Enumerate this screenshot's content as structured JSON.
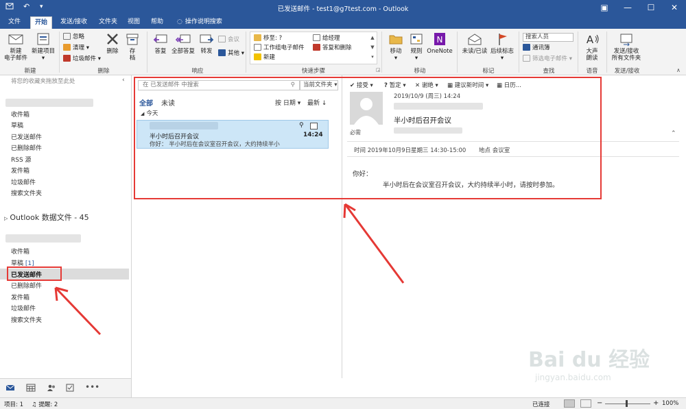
{
  "window": {
    "title": "已发送邮件 - test1@g7test.com - Outlook",
    "restore_icon": "▣",
    "minimize_icon": "—",
    "maximize_icon": "☐",
    "close_icon": "✕"
  },
  "tabs": [
    {
      "label": "文件"
    },
    {
      "label": "开始"
    },
    {
      "label": "发送/接收"
    },
    {
      "label": "文件夹"
    },
    {
      "label": "视图"
    },
    {
      "label": "帮助"
    },
    {
      "label": "操作说明搜索"
    }
  ],
  "ribbon": {
    "new_email": "新建\n电子邮件",
    "new_item": "新建项目",
    "group_new": "新建",
    "ignore": "忽略",
    "cleanup": "清理",
    "junk": "垃圾邮件",
    "delete": "删除",
    "archive": "存\n档",
    "group_delete": "删除",
    "reply": "答复",
    "reply_all": "全部答复",
    "forward": "转发",
    "meeting": "会议",
    "more": "其他",
    "group_respond": "响应",
    "qs_move": "移至: ?",
    "qs_team": "工作组电子邮件",
    "qs_new": "新建",
    "qs_manager": "给经理",
    "qs_reply_delete": "答复和删除",
    "group_quicksteps": "快速步骤",
    "move": "移动",
    "rules": "规则",
    "onenote": "OneNote",
    "group_move": "移动",
    "unread_read": "未读/已读",
    "followup": "后续标志",
    "group_tags": "标记",
    "search_people": "搜索人员",
    "address_book": "通讯簿",
    "filter_email": "筛选电子邮件",
    "group_find": "查找",
    "read_aloud": "大声\n朗读",
    "group_speech": "语音",
    "send_receive_all": "发送/接收\n所有文件夹",
    "group_sendreceive": "发送/接收"
  },
  "nav": {
    "favorites_hint": "将您的收藏夹拖放至此处",
    "account1_folders": [
      "收件箱",
      "草稿",
      "已发送邮件",
      "已删除邮件",
      "RSS 源",
      "发件箱",
      "垃圾邮件",
      "搜索文件夹"
    ],
    "datafile": "Outlook 数据文件 - 45",
    "account2_folders": [
      "收件箱",
      "草稿",
      "已发送邮件",
      "已删除邮件",
      "发件箱",
      "垃圾邮件",
      "搜索文件夹"
    ],
    "drafts_count": "[1]"
  },
  "list": {
    "search_placeholder": "在 已发送邮件 中搜索",
    "scope": "当前文件夹",
    "filter_all": "全部",
    "filter_unread": "未读",
    "sort_by": "按 日期",
    "sort_order": "最新",
    "group_today": "今天",
    "item": {
      "subject": "半小时后召开会议",
      "preview": "你好：   半小时后在会议室召开会议，大约持续半小",
      "time": "14:24"
    }
  },
  "reading": {
    "actions": [
      "接受",
      "暂定",
      "谢绝",
      "建议新时间",
      "日历..."
    ],
    "date": "2019/10/9 (周三) 14:24",
    "subject": "半小时后召开会议",
    "required": "必需",
    "when": "时间 2019年10月9日星期三 14:30-15:00",
    "where": "地点 会议室",
    "greeting": "你好：",
    "body": "半小时后在会议室召开会议，大约持续半小时，请按时参加。"
  },
  "status": {
    "items": "项目: 1",
    "reminders": "提醒: 2",
    "connected": "已连接",
    "zoom": "100%"
  },
  "colors": {
    "brand": "#2b579a",
    "highlight": "#cde6f7",
    "annotation": "#e53935"
  },
  "watermark": {
    "logo": "Bai du 经验",
    "url": "jingyan.baidu.com"
  }
}
